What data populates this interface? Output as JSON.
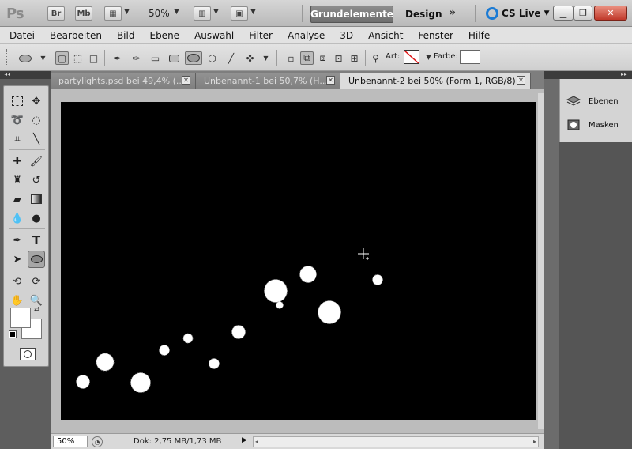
{
  "appbar": {
    "logo": "Ps",
    "bridge": "Br",
    "minibridge": "Mb",
    "zoom": "50%",
    "workspace_active": "Grundelemente",
    "workspace_design": "Design",
    "workspace_more": "»",
    "cslive": "CS Live"
  },
  "menu": [
    "Datei",
    "Bearbeiten",
    "Bild",
    "Ebene",
    "Auswahl",
    "Filter",
    "Analyse",
    "3D",
    "Ansicht",
    "Fenster",
    "Hilfe"
  ],
  "options": {
    "art_label": "Art:",
    "farbe_label": "Farbe:"
  },
  "tabs": [
    {
      "label": "partylights.psd bei 49,4% (..."
    },
    {
      "label": "Unbenannt-1 bei 50,7% (H..."
    },
    {
      "label": "Unbenannt-2 bei 50% (Form 1, RGB/8) *"
    }
  ],
  "status": {
    "zoom": "50%",
    "doc": "Dok: 2,75 MB/1,73 MB"
  },
  "panels": [
    {
      "label": "Ebenen",
      "icon": "layers-icon"
    },
    {
      "label": "Masken",
      "icon": "mask-icon"
    }
  ],
  "colors": {
    "canvas": "#000000",
    "dot": "#ffffff",
    "active_workspace": "#7a7a7a"
  }
}
